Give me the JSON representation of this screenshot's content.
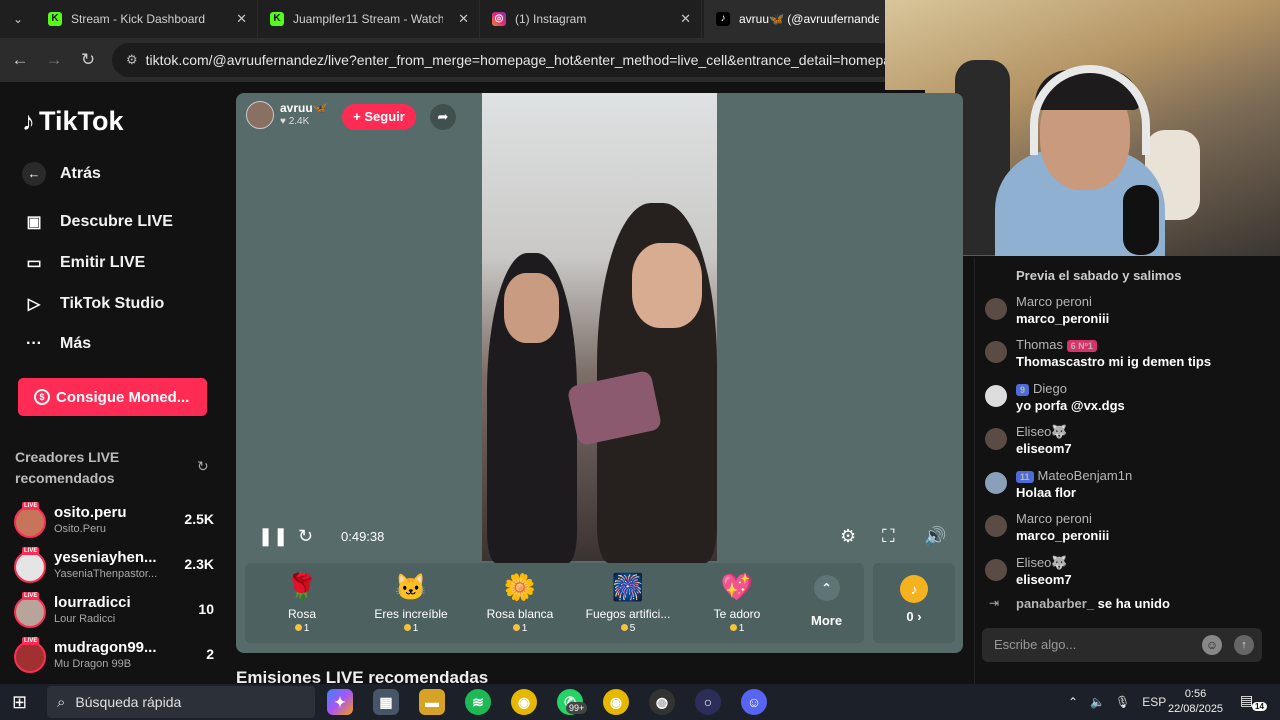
{
  "browser": {
    "tabs": [
      {
        "title": "Stream - Kick Dashboard",
        "icon": "kick-icon"
      },
      {
        "title": "Juampifer11 Stream - Watch Live",
        "icon": "kick-icon"
      },
      {
        "title": "(1) Instagram",
        "icon": "instagram-icon"
      },
      {
        "title": "avruu🦋 (@avruufernandez",
        "icon": "tiktok-icon"
      }
    ],
    "url": "tiktok.com/@avruufernandez/live?enter_from_merge=homepage_hot&enter_method=live_cell&entrance_detail=homepage_hot"
  },
  "sidebar": {
    "logo": "TikTok",
    "back": "Atrás",
    "items": [
      {
        "label": "Descubre LIVE",
        "icon": "live-tv-icon"
      },
      {
        "label": "Emitir LIVE",
        "icon": "video-camera-icon"
      },
      {
        "label": "TikTok Studio",
        "icon": "studio-icon"
      },
      {
        "label": "Más",
        "icon": "more-dots-icon"
      }
    ],
    "coins_button": "Consigue Moned...",
    "recommended_title": "Creadores LIVE recomendados",
    "creators": [
      {
        "name": "osito.peru",
        "sub": "Osito.Peru",
        "count": "2.5K"
      },
      {
        "name": "yeseniayhen...",
        "sub": "YaseniaThenpastor...",
        "count": "2.3K"
      },
      {
        "name": "lourradicci",
        "sub": "Lour Radicci",
        "count": "10"
      },
      {
        "name": "mudragon99...",
        "sub": "Mu Dragon 99B",
        "count": "2"
      }
    ]
  },
  "player": {
    "host_name": "avruu🦋",
    "host_likes": "♥ 2.4K",
    "follow_label": "+ Seguir",
    "elapsed": "0:49:38",
    "gifts": [
      {
        "name": "Rosa",
        "price": "1",
        "icon": "🌹"
      },
      {
        "name": "Eres increíble",
        "price": "1",
        "icon": "🐱"
      },
      {
        "name": "Rosa blanca",
        "price": "1",
        "icon": "🌼"
      },
      {
        "name": "Fuegos artifici...",
        "price": "5",
        "icon": "🎆"
      },
      {
        "name": "Te adoro",
        "price": "1",
        "icon": "💖"
      }
    ],
    "more_label": "More",
    "coins_value": "0 ›"
  },
  "recommended_heading": "Emisiones LIVE recomendadas",
  "chat": {
    "messages": [
      {
        "user": "",
        "badge": "",
        "text": "Previa el sabado y salimos"
      },
      {
        "user": "Marco peroni",
        "badge": "",
        "text": "marco_peroniii"
      },
      {
        "user": "Thomas",
        "badge": "6 Nº1",
        "text": "Thomascastro mi ig demen tips"
      },
      {
        "user": "Diego",
        "badge": "9",
        "text": "yo porfa @vx.dgs"
      },
      {
        "user": "Eliseo🐺",
        "badge": "",
        "text": "eliseom7"
      },
      {
        "user": "MateoBenjam1n",
        "badge": "11",
        "text": "Holaa flor"
      },
      {
        "user": "Marco peroni",
        "badge": "",
        "text": "marco_peroniii"
      },
      {
        "user": "Eliseo🐺",
        "badge": "",
        "text": "eliseom7"
      }
    ],
    "join_user": "panabarber_",
    "join_text": "se ha unido",
    "input_placeholder": "Escribe algo..."
  },
  "taskbar": {
    "search_placeholder": "Búsqueda rápida",
    "whatsapp_badge": "99+",
    "lang": "ESP",
    "time": "0:56",
    "date": "22/08/2025",
    "notifications": "14"
  }
}
